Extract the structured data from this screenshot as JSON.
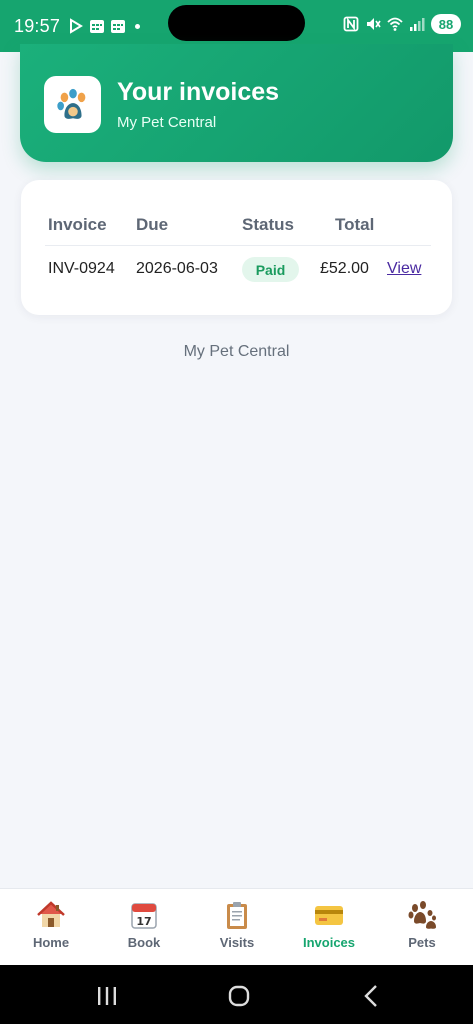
{
  "status_bar": {
    "time": "19:57",
    "battery": "88",
    "icons": [
      "play-icon",
      "calendar-icon",
      "calendar-icon",
      "nfc-icon",
      "mute-icon",
      "wifi-icon",
      "signal-icon"
    ]
  },
  "header": {
    "title": "Your invoices",
    "subtitle": "My Pet Central",
    "logo": "paw-logo"
  },
  "invoices_table": {
    "columns": [
      "Invoice",
      "Due",
      "Status",
      "Total"
    ],
    "rows": [
      {
        "invoice": "INV-0924",
        "due": "2026-06-03",
        "status": "Paid",
        "total": "£52.00",
        "action": "View"
      }
    ]
  },
  "footer": {
    "text": "My Pet Central"
  },
  "bottom_nav": {
    "items": [
      {
        "label": "Home",
        "icon": "house-icon"
      },
      {
        "label": "Book",
        "icon": "calendar-icon"
      },
      {
        "label": "Visits",
        "icon": "clipboard-icon"
      },
      {
        "label": "Invoices",
        "icon": "credit-card-icon",
        "active": true
      },
      {
        "label": "Pets",
        "icon": "paw-icon"
      }
    ]
  },
  "colors": {
    "brand_green": "#16a56f",
    "paid_green": "#1a9b5e",
    "link_purple": "#4a2aa1"
  }
}
